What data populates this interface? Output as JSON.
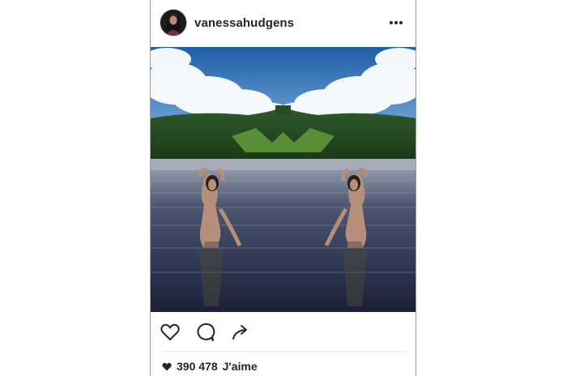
{
  "post": {
    "username": "vanessahudgens",
    "likes_count": "390 478",
    "likes_label": "J'aime"
  },
  "icons": {
    "more": "more-horizontal-icon",
    "like": "heart-outline-icon",
    "comment": "comment-bubble-icon",
    "share": "share-arrow-icon",
    "likes": "heart-filled-icon"
  },
  "colors": {
    "text": "#262626",
    "border": "#9a9a9a"
  }
}
